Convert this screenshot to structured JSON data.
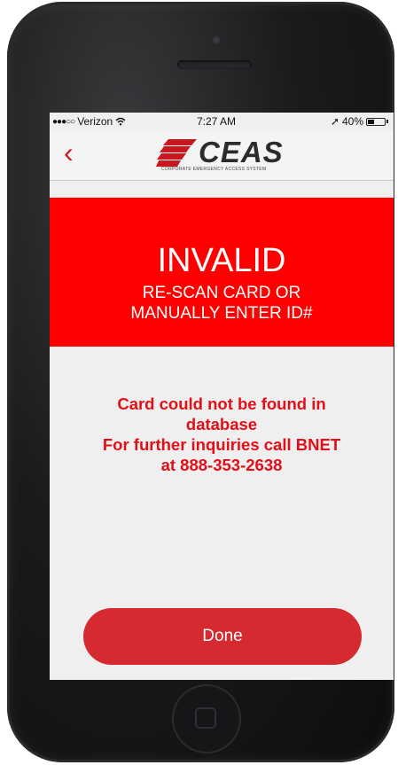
{
  "status_bar": {
    "signal": "●●●○○",
    "carrier": "Verizon",
    "wifi_icon": "wifi-icon",
    "time": "7:27 AM",
    "location_icon": "➚",
    "battery": "40%",
    "battery_level": 0.4
  },
  "navbar": {
    "back_glyph": "‹",
    "logo_text": "CEAS",
    "logo_subtitle": "CORPORATE EMERGENCY ACCESS SYSTEM"
  },
  "alert": {
    "title": "INVALID",
    "line1": "RE-SCAN CARD OR",
    "line2": "MANUALLY ENTER ID#"
  },
  "message": {
    "line1": "Card could not be found in",
    "line2": "database",
    "line3": "For further inquiries call BNET",
    "line4": "at 888-353-2638"
  },
  "done_label": "Done",
  "colors": {
    "alert_red": "#ff0000",
    "message_red": "#e40f16",
    "button_red": "#d52a30",
    "accent_red": "#c8171e"
  }
}
